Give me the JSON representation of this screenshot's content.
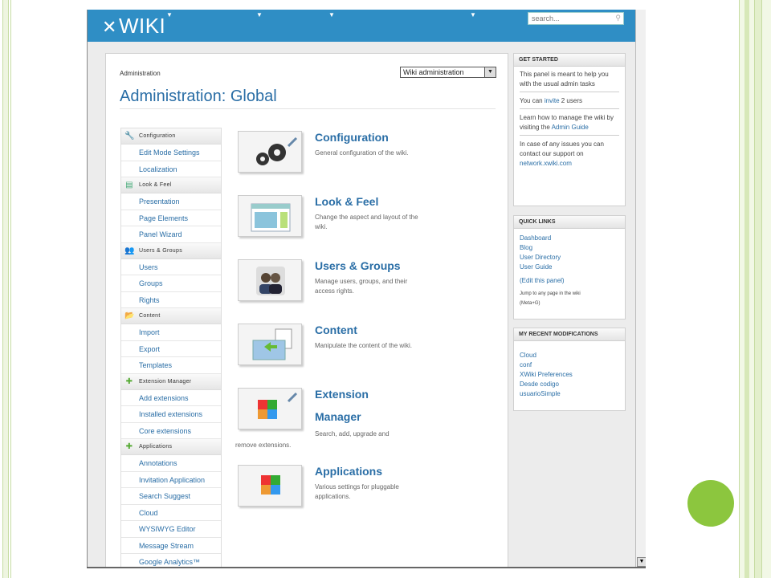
{
  "header": {
    "logo": "WIKI"
  },
  "search": {
    "placeholder": "search..."
  },
  "main": {
    "breadcrumb": "Administration",
    "wiki_selector": "Wiki administration",
    "title": "Administration: Global"
  },
  "menu": [
    {
      "label": "Configuration",
      "icon": "wrench-icon",
      "items": [
        "Edit Mode Settings",
        "Localization"
      ]
    },
    {
      "label": "Look & Feel",
      "icon": "palette-icon",
      "items": [
        "Presentation",
        "Page Elements",
        "Panel Wizard"
      ]
    },
    {
      "label": "Users & Groups",
      "icon": "users-icon",
      "items": [
        "Users",
        "Groups",
        "Rights"
      ]
    },
    {
      "label": "Content",
      "icon": "folder-icon",
      "items": [
        "Import",
        "Export",
        "Templates"
      ]
    },
    {
      "label": "Extension Manager",
      "icon": "puzzle-icon",
      "items": [
        "Add extensions",
        "Installed extensions",
        "Core extensions"
      ]
    },
    {
      "label": "Applications",
      "icon": "puzzle-icon",
      "items": [
        "Annotations",
        "Invitation Application",
        "Search Suggest",
        "Cloud",
        "WYSIWYG Editor",
        "Message Stream",
        "Google Analytics™"
      ]
    }
  ],
  "sections": [
    {
      "title": "Configuration",
      "desc": "General configuration of the wiki.",
      "icon": "gears-icon"
    },
    {
      "title": "Look & Feel",
      "desc": "Change the aspect and layout of the wiki.",
      "icon": "layout-icon"
    },
    {
      "title": "Users & Groups",
      "desc": "Manage users, groups, and their access rights.",
      "icon": "users-icon"
    },
    {
      "title": "Content",
      "desc": "Manipulate the content of the wiki.",
      "icon": "folder-icon"
    },
    {
      "title": "Extension",
      "title2": "Manager",
      "desc": "Search, add, upgrade and",
      "desc2": "remove extensions.",
      "icon": "puzzle-icon"
    },
    {
      "title": "Applications",
      "desc": "Various settings for pluggable applications.",
      "icon": "puzzle-icon"
    }
  ],
  "panels": {
    "get_started": {
      "title": "GET STARTED",
      "intro": "This panel is meant to help you with the usual admin tasks",
      "invite_prefix": "You can ",
      "invite_link": "invite",
      "invite_suffix": " 2 users",
      "guide_prefix": "Learn how to manage the wiki by visiting the ",
      "guide_link": "Admin Guide",
      "support_prefix": "In case of any issues you can contact our support on ",
      "support_link": "network.xwiki.com"
    },
    "quick_links": {
      "title": "QUICK LINKS",
      "links": [
        "Dashboard",
        "Blog",
        "User Directory",
        "User Guide"
      ],
      "edit": "(Edit this panel)",
      "jump": "Jump to any page in the wiki",
      "shortcut": "(Meta+G)"
    },
    "recent": {
      "title": "MY RECENT MODIFICATIONS",
      "links": [
        "Cloud",
        "conf",
        "XWiki Preferences",
        "Desde codigo",
        "usuarioSimple"
      ]
    }
  }
}
